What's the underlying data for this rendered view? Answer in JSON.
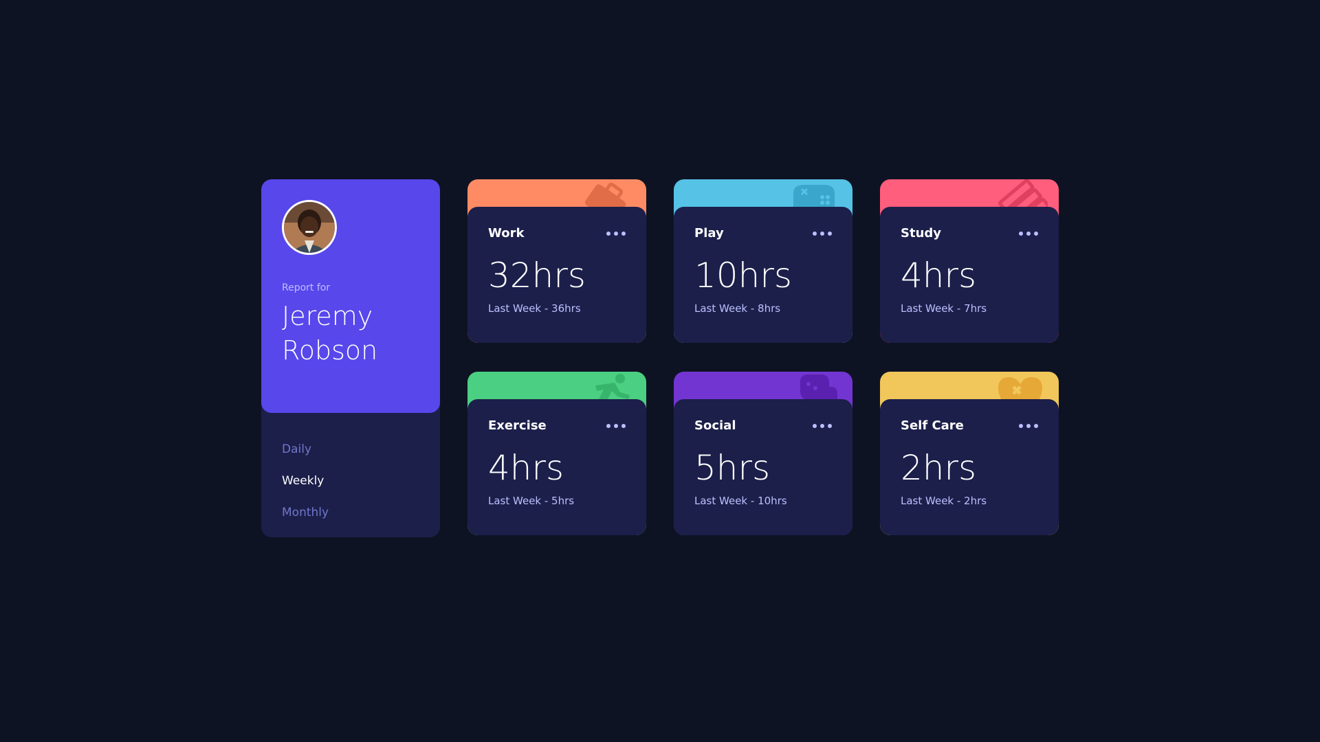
{
  "profile": {
    "report_label": "Report for",
    "name": "Jeremy Robson",
    "periods": [
      {
        "label": "Daily",
        "active": false
      },
      {
        "label": "Weekly",
        "active": true
      },
      {
        "label": "Monthly",
        "active": false
      }
    ]
  },
  "cards": [
    {
      "title": "Work",
      "current": "32hrs",
      "previous": "Last Week - 36hrs",
      "color": "#ff8b64",
      "icon": "briefcase-icon"
    },
    {
      "title": "Play",
      "current": "10hrs",
      "previous": "Last Week - 8hrs",
      "color": "#55c2e6",
      "icon": "gamepad-icon"
    },
    {
      "title": "Study",
      "current": "4hrs",
      "previous": "Last Week - 7hrs",
      "color": "#ff5e7d",
      "icon": "books-icon"
    },
    {
      "title": "Exercise",
      "current": "4hrs",
      "previous": "Last Week - 5hrs",
      "color": "#4bcf82",
      "icon": "runner-icon"
    },
    {
      "title": "Social",
      "current": "5hrs",
      "previous": "Last Week - 10hrs",
      "color": "#7335d2",
      "icon": "chat-bubbles-icon"
    },
    {
      "title": "Self Care",
      "current": "2hrs",
      "previous": "Last Week - 2hrs",
      "color": "#f1c75b",
      "icon": "heart-care-icon"
    }
  ],
  "colors": {
    "background": "#0e1323",
    "card": "#1c1f4a",
    "profile": "#5847eb",
    "muted_text": "#bbc0ff",
    "inactive_period": "#7078c9"
  }
}
